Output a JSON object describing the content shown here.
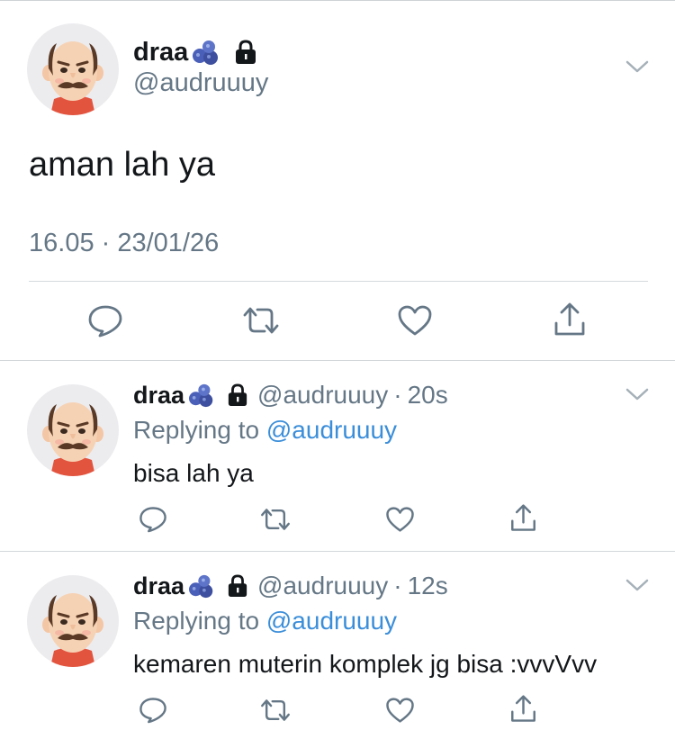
{
  "main_tweet": {
    "display_name": "draa",
    "handle": "@audruuuy",
    "text": "aman lah ya",
    "timestamp": "16.05 · 23/01/26"
  },
  "replies": [
    {
      "display_name": "draa",
      "handle": "@audruuuy",
      "separator": "·",
      "age": "20s",
      "replying_prefix": "Replying to",
      "replying_to": "@audruuuy",
      "text": "bisa lah ya"
    },
    {
      "display_name": "draa",
      "handle": "@audruuuy",
      "separator": "·",
      "age": "12s",
      "replying_prefix": "Replying to",
      "replying_to": "@audruuuy",
      "text": "kemaren muterin komplek jg bisa :vvvVvv"
    }
  ],
  "icons": {
    "name_emoji": "blueberries-emoji",
    "protected": "lock-icon",
    "menu": "chevron-down-icon",
    "actions": [
      "reply-icon",
      "retweet-icon",
      "like-icon",
      "share-icon"
    ]
  },
  "colors": {
    "text": "#14171a",
    "secondary_text": "#657786",
    "link": "#3b8ed9",
    "divider": "#d6dadd"
  }
}
